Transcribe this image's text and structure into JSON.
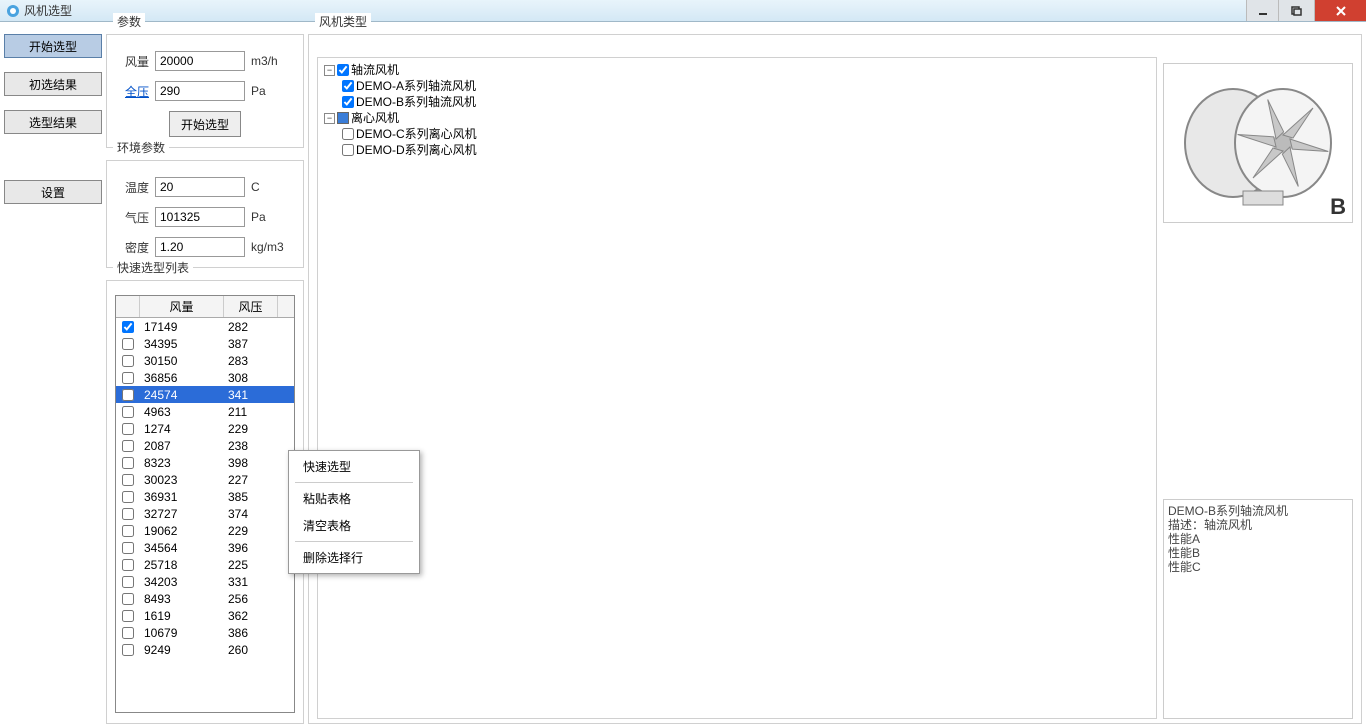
{
  "title": "风机选型",
  "nav": {
    "start": "开始选型",
    "prelim": "初选结果",
    "result": "选型结果",
    "settings": "设置"
  },
  "params_group": {
    "title": "参数",
    "flow_label": "风量",
    "flow_value": "20000",
    "flow_unit": "m3/h",
    "pressure_label": "全压",
    "pressure_value": "290",
    "pressure_unit": "Pa",
    "start_button": "开始选型"
  },
  "env_group": {
    "title": "环境参数",
    "temp_label": "温度",
    "temp_value": "20",
    "temp_unit": "C",
    "baro_label": "气压",
    "baro_value": "101325",
    "baro_unit": "Pa",
    "density_label": "密度",
    "density_value": "1.20",
    "density_unit": "kg/m3"
  },
  "quick_list": {
    "title": "快速选型列表",
    "col_flow": "风量",
    "col_press": "风压",
    "rows": [
      {
        "checked": true,
        "flow": "17149",
        "press": "282"
      },
      {
        "checked": false,
        "flow": "34395",
        "press": "387"
      },
      {
        "checked": false,
        "flow": "30150",
        "press": "283"
      },
      {
        "checked": false,
        "flow": "36856",
        "press": "308"
      },
      {
        "checked": false,
        "flow": "24574",
        "press": "341",
        "selected": true
      },
      {
        "checked": false,
        "flow": "4963",
        "press": "211"
      },
      {
        "checked": false,
        "flow": "1274",
        "press": "229"
      },
      {
        "checked": false,
        "flow": "2087",
        "press": "238"
      },
      {
        "checked": false,
        "flow": "8323",
        "press": "398"
      },
      {
        "checked": false,
        "flow": "30023",
        "press": "227"
      },
      {
        "checked": false,
        "flow": "36931",
        "press": "385"
      },
      {
        "checked": false,
        "flow": "32727",
        "press": "374"
      },
      {
        "checked": false,
        "flow": "19062",
        "press": "229"
      },
      {
        "checked": false,
        "flow": "34564",
        "press": "396"
      },
      {
        "checked": false,
        "flow": "25718",
        "press": "225"
      },
      {
        "checked": false,
        "flow": "34203",
        "press": "331"
      },
      {
        "checked": false,
        "flow": "8493",
        "press": "256"
      },
      {
        "checked": false,
        "flow": "1619",
        "press": "362"
      },
      {
        "checked": false,
        "flow": "10679",
        "press": "386"
      },
      {
        "checked": false,
        "flow": "9249",
        "press": "260"
      }
    ]
  },
  "fan_type": {
    "title": "风机类型",
    "tree": {
      "axial": {
        "label": "轴流风机",
        "checked": true,
        "children": [
          {
            "label": "DEMO-A系列轴流风机",
            "checked": true
          },
          {
            "label": "DEMO-B系列轴流风机",
            "checked": true
          }
        ]
      },
      "centrifugal": {
        "label": "离心风机",
        "partial": true,
        "children": [
          {
            "label": "DEMO-C系列离心风机",
            "checked": false
          },
          {
            "label": "DEMO-D系列离心风机",
            "checked": false
          }
        ]
      }
    }
  },
  "image_letter": "B",
  "desc": "DEMO-B系列轴流风机\n描述：轴流风机\n性能A\n性能B\n性能C",
  "context_menu": {
    "quick": "快速选型",
    "paste": "粘贴表格",
    "clear": "清空表格",
    "delete": "删除选择行"
  }
}
